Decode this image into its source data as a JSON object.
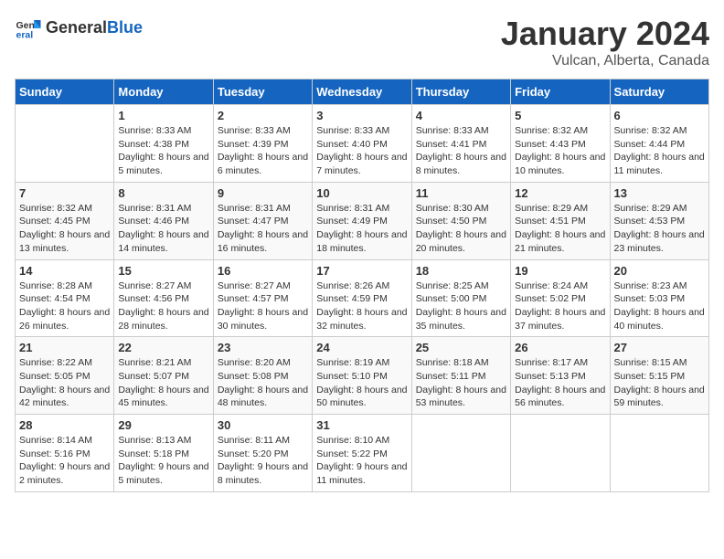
{
  "header": {
    "logo_general": "General",
    "logo_blue": "Blue",
    "month": "January 2024",
    "location": "Vulcan, Alberta, Canada"
  },
  "weekdays": [
    "Sunday",
    "Monday",
    "Tuesday",
    "Wednesday",
    "Thursday",
    "Friday",
    "Saturday"
  ],
  "weeks": [
    [
      {
        "day": "",
        "sunrise": "",
        "sunset": "",
        "daylight": ""
      },
      {
        "day": "1",
        "sunrise": "Sunrise: 8:33 AM",
        "sunset": "Sunset: 4:38 PM",
        "daylight": "Daylight: 8 hours and 5 minutes."
      },
      {
        "day": "2",
        "sunrise": "Sunrise: 8:33 AM",
        "sunset": "Sunset: 4:39 PM",
        "daylight": "Daylight: 8 hours and 6 minutes."
      },
      {
        "day": "3",
        "sunrise": "Sunrise: 8:33 AM",
        "sunset": "Sunset: 4:40 PM",
        "daylight": "Daylight: 8 hours and 7 minutes."
      },
      {
        "day": "4",
        "sunrise": "Sunrise: 8:33 AM",
        "sunset": "Sunset: 4:41 PM",
        "daylight": "Daylight: 8 hours and 8 minutes."
      },
      {
        "day": "5",
        "sunrise": "Sunrise: 8:32 AM",
        "sunset": "Sunset: 4:43 PM",
        "daylight": "Daylight: 8 hours and 10 minutes."
      },
      {
        "day": "6",
        "sunrise": "Sunrise: 8:32 AM",
        "sunset": "Sunset: 4:44 PM",
        "daylight": "Daylight: 8 hours and 11 minutes."
      }
    ],
    [
      {
        "day": "7",
        "sunrise": "Sunrise: 8:32 AM",
        "sunset": "Sunset: 4:45 PM",
        "daylight": "Daylight: 8 hours and 13 minutes."
      },
      {
        "day": "8",
        "sunrise": "Sunrise: 8:31 AM",
        "sunset": "Sunset: 4:46 PM",
        "daylight": "Daylight: 8 hours and 14 minutes."
      },
      {
        "day": "9",
        "sunrise": "Sunrise: 8:31 AM",
        "sunset": "Sunset: 4:47 PM",
        "daylight": "Daylight: 8 hours and 16 minutes."
      },
      {
        "day": "10",
        "sunrise": "Sunrise: 8:31 AM",
        "sunset": "Sunset: 4:49 PM",
        "daylight": "Daylight: 8 hours and 18 minutes."
      },
      {
        "day": "11",
        "sunrise": "Sunrise: 8:30 AM",
        "sunset": "Sunset: 4:50 PM",
        "daylight": "Daylight: 8 hours and 20 minutes."
      },
      {
        "day": "12",
        "sunrise": "Sunrise: 8:29 AM",
        "sunset": "Sunset: 4:51 PM",
        "daylight": "Daylight: 8 hours and 21 minutes."
      },
      {
        "day": "13",
        "sunrise": "Sunrise: 8:29 AM",
        "sunset": "Sunset: 4:53 PM",
        "daylight": "Daylight: 8 hours and 23 minutes."
      }
    ],
    [
      {
        "day": "14",
        "sunrise": "Sunrise: 8:28 AM",
        "sunset": "Sunset: 4:54 PM",
        "daylight": "Daylight: 8 hours and 26 minutes."
      },
      {
        "day": "15",
        "sunrise": "Sunrise: 8:27 AM",
        "sunset": "Sunset: 4:56 PM",
        "daylight": "Daylight: 8 hours and 28 minutes."
      },
      {
        "day": "16",
        "sunrise": "Sunrise: 8:27 AM",
        "sunset": "Sunset: 4:57 PM",
        "daylight": "Daylight: 8 hours and 30 minutes."
      },
      {
        "day": "17",
        "sunrise": "Sunrise: 8:26 AM",
        "sunset": "Sunset: 4:59 PM",
        "daylight": "Daylight: 8 hours and 32 minutes."
      },
      {
        "day": "18",
        "sunrise": "Sunrise: 8:25 AM",
        "sunset": "Sunset: 5:00 PM",
        "daylight": "Daylight: 8 hours and 35 minutes."
      },
      {
        "day": "19",
        "sunrise": "Sunrise: 8:24 AM",
        "sunset": "Sunset: 5:02 PM",
        "daylight": "Daylight: 8 hours and 37 minutes."
      },
      {
        "day": "20",
        "sunrise": "Sunrise: 8:23 AM",
        "sunset": "Sunset: 5:03 PM",
        "daylight": "Daylight: 8 hours and 40 minutes."
      }
    ],
    [
      {
        "day": "21",
        "sunrise": "Sunrise: 8:22 AM",
        "sunset": "Sunset: 5:05 PM",
        "daylight": "Daylight: 8 hours and 42 minutes."
      },
      {
        "day": "22",
        "sunrise": "Sunrise: 8:21 AM",
        "sunset": "Sunset: 5:07 PM",
        "daylight": "Daylight: 8 hours and 45 minutes."
      },
      {
        "day": "23",
        "sunrise": "Sunrise: 8:20 AM",
        "sunset": "Sunset: 5:08 PM",
        "daylight": "Daylight: 8 hours and 48 minutes."
      },
      {
        "day": "24",
        "sunrise": "Sunrise: 8:19 AM",
        "sunset": "Sunset: 5:10 PM",
        "daylight": "Daylight: 8 hours and 50 minutes."
      },
      {
        "day": "25",
        "sunrise": "Sunrise: 8:18 AM",
        "sunset": "Sunset: 5:11 PM",
        "daylight": "Daylight: 8 hours and 53 minutes."
      },
      {
        "day": "26",
        "sunrise": "Sunrise: 8:17 AM",
        "sunset": "Sunset: 5:13 PM",
        "daylight": "Daylight: 8 hours and 56 minutes."
      },
      {
        "day": "27",
        "sunrise": "Sunrise: 8:15 AM",
        "sunset": "Sunset: 5:15 PM",
        "daylight": "Daylight: 8 hours and 59 minutes."
      }
    ],
    [
      {
        "day": "28",
        "sunrise": "Sunrise: 8:14 AM",
        "sunset": "Sunset: 5:16 PM",
        "daylight": "Daylight: 9 hours and 2 minutes."
      },
      {
        "day": "29",
        "sunrise": "Sunrise: 8:13 AM",
        "sunset": "Sunset: 5:18 PM",
        "daylight": "Daylight: 9 hours and 5 minutes."
      },
      {
        "day": "30",
        "sunrise": "Sunrise: 8:11 AM",
        "sunset": "Sunset: 5:20 PM",
        "daylight": "Daylight: 9 hours and 8 minutes."
      },
      {
        "day": "31",
        "sunrise": "Sunrise: 8:10 AM",
        "sunset": "Sunset: 5:22 PM",
        "daylight": "Daylight: 9 hours and 11 minutes."
      },
      {
        "day": "",
        "sunrise": "",
        "sunset": "",
        "daylight": ""
      },
      {
        "day": "",
        "sunrise": "",
        "sunset": "",
        "daylight": ""
      },
      {
        "day": "",
        "sunrise": "",
        "sunset": "",
        "daylight": ""
      }
    ]
  ]
}
